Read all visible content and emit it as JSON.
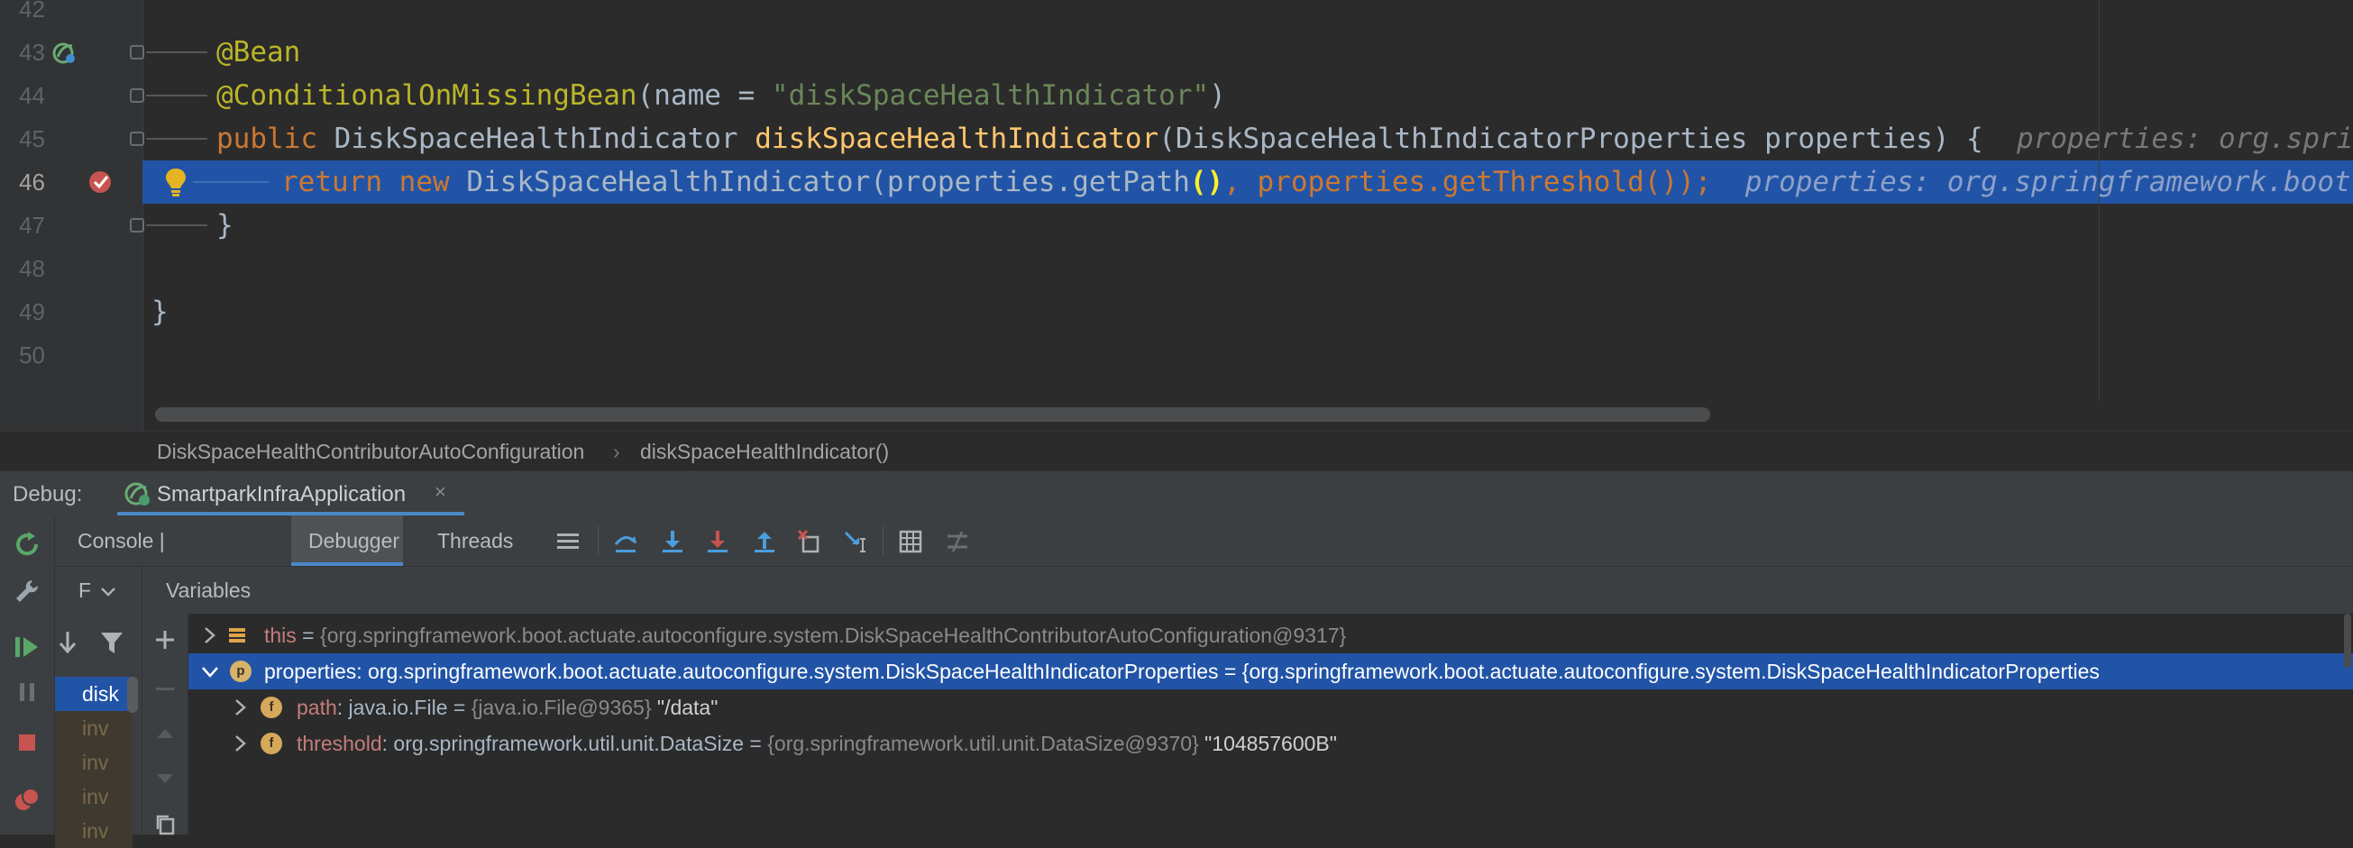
{
  "editor": {
    "lines": [
      {
        "num": "42"
      },
      {
        "num": "43",
        "code": "@Bean"
      },
      {
        "num": "44",
        "ann": "@ConditionalOnMissingBean",
        "p1": "(name = ",
        "str": "\"diskSpaceHealthIndicator\"",
        "p2": ")"
      },
      {
        "num": "45",
        "kw": "public",
        "type": "DiskSpaceHealthIndicator",
        "fn": "diskSpaceHealthIndicator",
        "rest": "(DiskSpaceHealthIndicatorProperties properties) {",
        "hint": "properties: org.springfra"
      },
      {
        "num": "46",
        "kw1": "return",
        "kw2": "new",
        "cls": "DiskSpaceHealthIndicator",
        "p1": "(properties.getPath",
        "paren": "()",
        "p2": ", properties.getThreshold());",
        "hint": "properties: org.springframework.boot.actu"
      },
      {
        "num": "47",
        "code": "}"
      },
      {
        "num": "48"
      },
      {
        "num": "49",
        "code": "}"
      },
      {
        "num": "50"
      }
    ]
  },
  "breadcrumb": {
    "class_name": "DiskSpaceHealthContributorAutoConfiguration",
    "separator": "›",
    "method_name": "diskSpaceHealthIndicator()"
  },
  "debug": {
    "label": "Debug:",
    "session": "SmartparkInfraApplication",
    "close": "×"
  },
  "tabs": {
    "console": "Console | Endpoints",
    "debugger": "Debugger",
    "threads": "Threads"
  },
  "frames": {
    "header": "F",
    "items": [
      "disk",
      "inv",
      "inv",
      "inv",
      "inv"
    ]
  },
  "variables": {
    "title": "Variables",
    "rows": [
      {
        "name": "this",
        "eq": " = ",
        "value": "{org.springframework.boot.actuate.autoconfigure.system.DiskSpaceHealthContributorAutoConfiguration@9317}"
      },
      {
        "name": "properties",
        "type": ": org.springframework.boot.actuate.autoconfigure.system.DiskSpaceHealthIndicatorProperties",
        "eq": "  = ",
        "value": "{org.springframework.boot.actuate.autoconfigure.system.DiskSpaceHealthIndicatorProperties",
        "icon": "p"
      },
      {
        "name": "path",
        "type": ": java.io.File",
        "eq": "  = ",
        "value": "{java.io.File@9365}",
        "str": " \"/data\"",
        "icon": "f"
      },
      {
        "name": "threshold",
        "type": ": org.springframework.util.unit.DataSize",
        "eq": "  = ",
        "value": "{org.springframework.util.unit.DataSize@9370}",
        "str": " \"104857600B\"",
        "icon": "f"
      }
    ]
  }
}
